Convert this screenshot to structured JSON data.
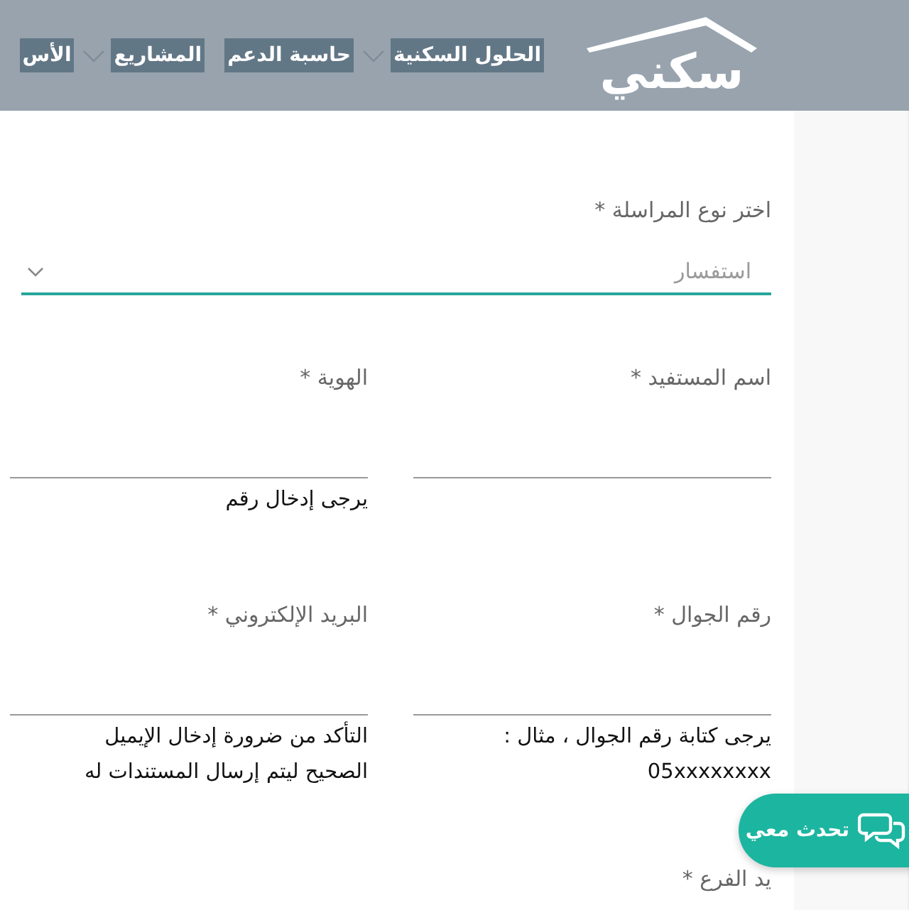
{
  "header": {
    "logo": "سكني",
    "nav": [
      {
        "label": "الحلول السكنية",
        "has_dropdown": true
      },
      {
        "label": "حاسبة الدعم",
        "has_dropdown": false
      },
      {
        "label": "المشاريع",
        "has_dropdown": true
      },
      {
        "label": "الأس",
        "has_dropdown": false
      }
    ]
  },
  "form": {
    "type_field": {
      "label": "اختر نوع المراسلة *",
      "value": "استفسار"
    },
    "rows": [
      [
        {
          "label": "اسم المستفيد *"
        },
        {
          "label": "الهوية *",
          "hint": [
            "يرجى إدخال رقم"
          ]
        }
      ],
      [
        {
          "label": "رقم الجوال *",
          "hint": [
            "يرجى كتابة رقم الجوال ، مثال :",
            "05xxxxxxxx"
          ]
        },
        {
          "label": "البريد الإلكتروني *",
          "hint": [
            "التأكد من ضرورة إدخال الإيميل",
            "الصحيح ليتم إرسال المستندات له"
          ]
        }
      ]
    ],
    "partial_label": "يد الفرع *"
  },
  "chat_button": {
    "label": "تحدث معي"
  }
}
